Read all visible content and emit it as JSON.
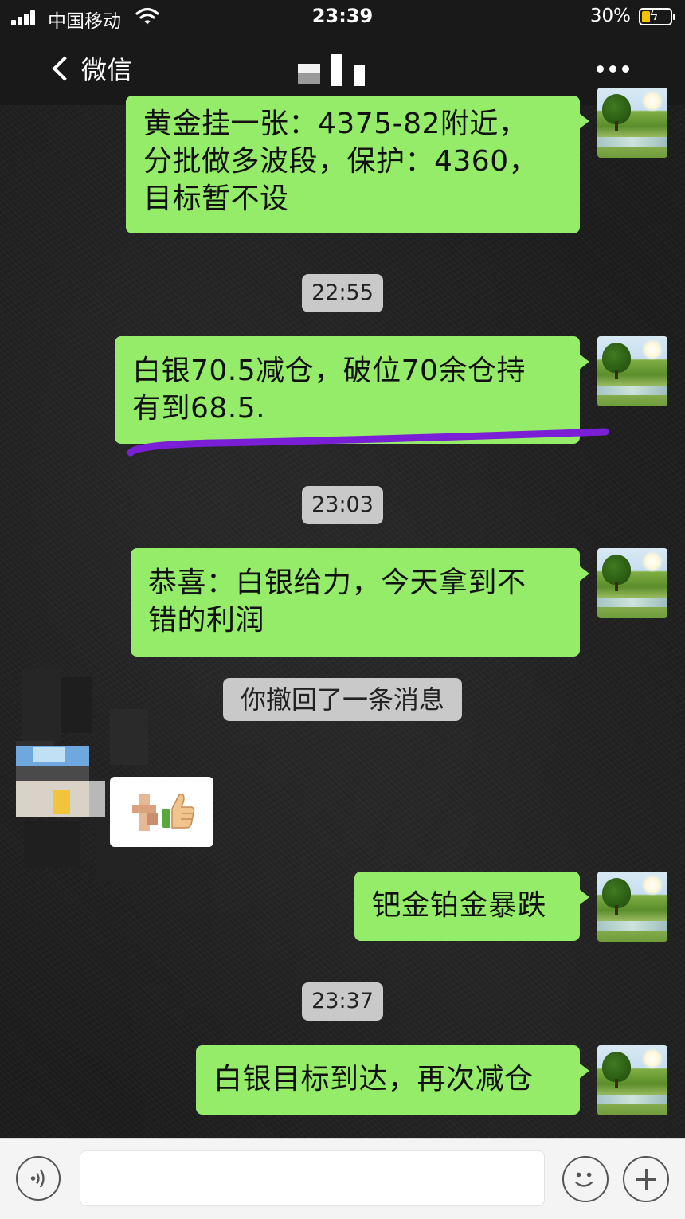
{
  "status_bar": {
    "carrier": "中国移动",
    "time": "23:39",
    "battery_percent": "30%",
    "battery_level": 0.3
  },
  "nav": {
    "back_label": "微信",
    "title_obscured": true
  },
  "messages": [
    {
      "type": "outgoing",
      "text_lines": [
        "黄金挂一张：4375-82附近，",
        "分批做多波段，保护：4360，",
        "目标暂不设"
      ]
    },
    {
      "type": "timestamp",
      "text": "22:55"
    },
    {
      "type": "outgoing",
      "text_lines": [
        "白银70.5减仓，破位70余仓持",
        "有到68.5."
      ]
    },
    {
      "type": "timestamp",
      "text": "23:03"
    },
    {
      "type": "outgoing",
      "text_lines": [
        "恭喜：白银给力，今天拿到不",
        "错的利润"
      ]
    },
    {
      "type": "system",
      "text": "你撤回了一条消息"
    },
    {
      "type": "incoming",
      "content": "thumbs-up-emoji",
      "sender_obscured": true
    },
    {
      "type": "outgoing",
      "text_lines": [
        "钯金铂金暴跌"
      ]
    },
    {
      "type": "timestamp",
      "text": "23:37"
    },
    {
      "type": "outgoing",
      "text_lines": [
        "白银目标到达，再次减仓"
      ]
    }
  ],
  "annotation": {
    "underline_color": "#7a1fd6"
  },
  "colors": {
    "outgoing_bubble": "#95ec69",
    "timestamp_bg": "#c9c9c9",
    "header_bg": "#191919"
  },
  "input_bar": {
    "text_value": ""
  }
}
